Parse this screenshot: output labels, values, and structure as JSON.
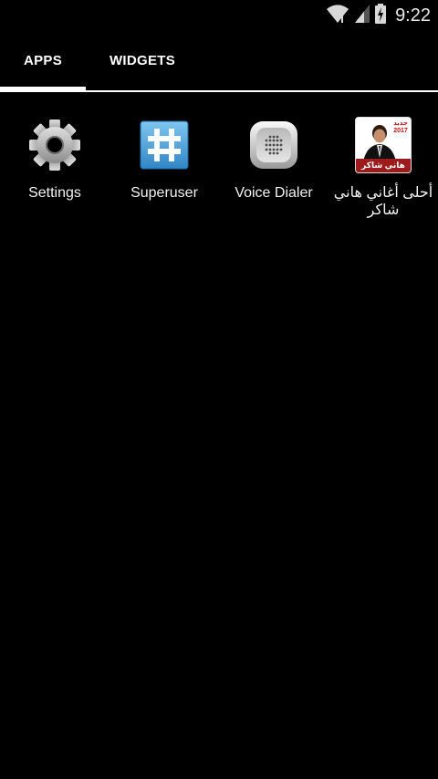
{
  "status_bar": {
    "time": "9:22",
    "icons": [
      "wifi-icon",
      "signal-icon",
      "battery-charging-icon"
    ]
  },
  "tabs": [
    {
      "label": "APPS",
      "active": true
    },
    {
      "label": "WIDGETS",
      "active": false
    }
  ],
  "apps": [
    {
      "label": "Settings",
      "icon": "gear-icon"
    },
    {
      "label": "Superuser",
      "icon": "hash-icon"
    },
    {
      "label": "Voice Dialer",
      "icon": "speaker-icon"
    },
    {
      "label": "أحلى أغاني هاني شاكر",
      "icon": "album-cover-icon",
      "cover": {
        "tag_word": "جديد",
        "tag_year": "2017",
        "banner": "هاني شاكر"
      }
    }
  ],
  "colors": {
    "background": "#000000",
    "tab_indicator": "#ffffff",
    "text": "#ffffff"
  }
}
